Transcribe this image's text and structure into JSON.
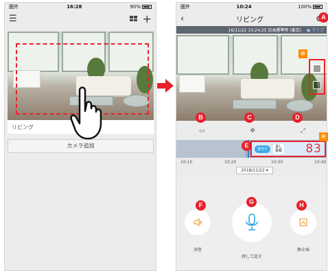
{
  "left_phone": {
    "status": {
      "carrier": "圏外",
      "time": "16:28",
      "battery": "90%"
    },
    "camera_label": "リビング",
    "add_camera_label": "カメラ追加"
  },
  "right_phone": {
    "status": {
      "carrier": "圏外",
      "time": "10:24",
      "battery": "100%"
    },
    "title": "リビング",
    "timestamp": "16/11/22 10:24:25 日本標準時 (東京)",
    "live_label": "● ライブ",
    "status_pill": "見守り",
    "status_text": "温し\n警報",
    "score": "83",
    "time_ticks": [
      "10:10",
      "10:20",
      "10:30",
      "10:40"
    ],
    "date_select": "2018/11/22",
    "buttons": {
      "mute_label": "消音",
      "talk_label": "押して話す",
      "snapshot_label": "静止画"
    }
  },
  "markers": [
    "A",
    "B",
    "C",
    "D",
    "E",
    "F",
    "G",
    "H"
  ],
  "warn_glyph": "※",
  "colors": {
    "marker_red": "#e8212b",
    "accent_blue": "#2aa8e0",
    "orange": "#f0a640"
  }
}
